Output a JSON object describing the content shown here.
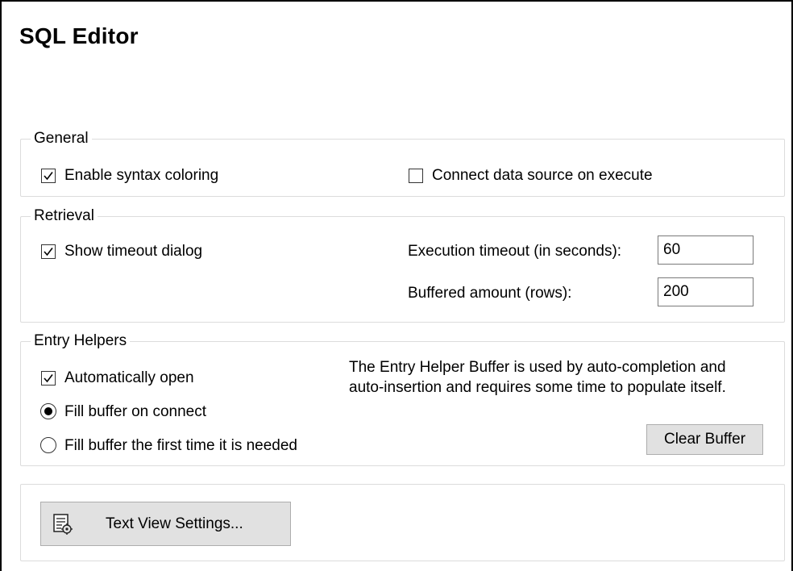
{
  "title": "SQL Editor",
  "general": {
    "legend": "General",
    "enable_syntax_coloring": {
      "label": "Enable syntax coloring",
      "checked": true
    },
    "connect_on_execute": {
      "label": "Connect data source on execute",
      "checked": false
    }
  },
  "retrieval": {
    "legend": "Retrieval",
    "show_timeout_dialog": {
      "label": "Show timeout dialog",
      "checked": true
    },
    "execution_timeout_label": "Execution timeout (in seconds):",
    "execution_timeout_value": "60",
    "buffered_amount_label": "Buffered amount (rows):",
    "buffered_amount_value": "200"
  },
  "entry_helpers": {
    "legend": "Entry Helpers",
    "automatically_open": {
      "label": "Automatically open",
      "checked": true
    },
    "fill_on_connect": {
      "label": "Fill buffer on connect",
      "selected": true
    },
    "fill_first_time": {
      "label": "Fill buffer the first time it is needed",
      "selected": false
    },
    "description_line1": "The Entry Helper Buffer is used by auto-completion and",
    "description_line2": "auto-insertion and requires some time to populate itself.",
    "clear_buffer_label": "Clear Buffer"
  },
  "text_view": {
    "button_label": "Text View Settings...",
    "icon": "text-settings-icon"
  }
}
